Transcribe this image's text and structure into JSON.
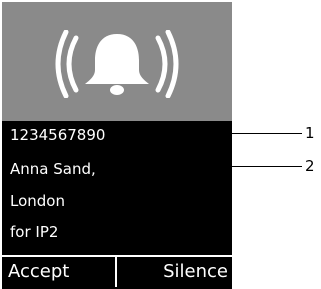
{
  "caller": {
    "number": "1234567890",
    "name": "Anna Sand,",
    "city": "London",
    "account": "for IP2"
  },
  "softkeys": {
    "left": "Accept",
    "right": "Silence"
  },
  "callouts": [
    "1",
    "2"
  ],
  "icons": {
    "alert": "ringing-bell-icon"
  },
  "colors": {
    "screen_background": "#000000",
    "header_background": "#8a8a8a",
    "foreground": "#ffffff"
  }
}
